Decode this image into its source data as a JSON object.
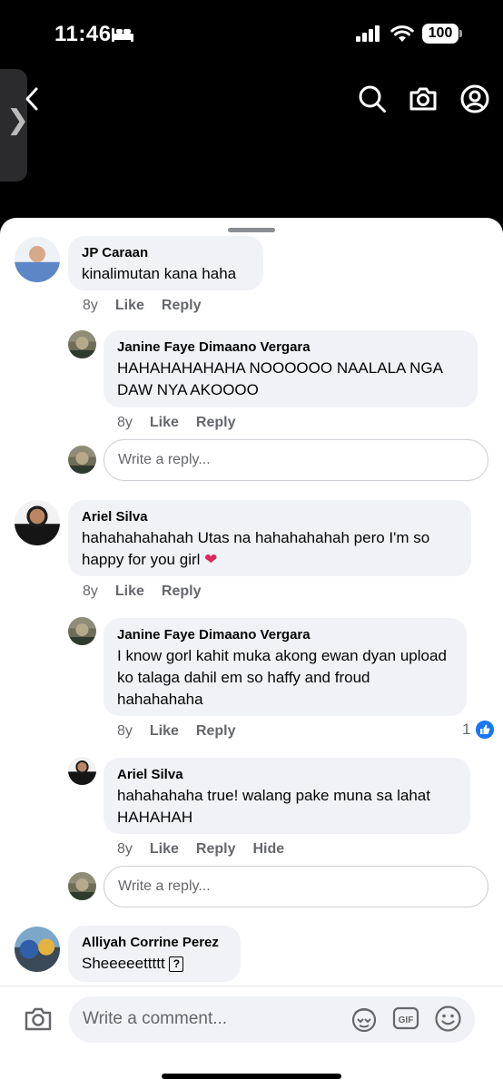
{
  "status_bar": {
    "time": "11:46",
    "battery": "100"
  },
  "comments": [
    {
      "author": "JP Caraan",
      "text": "kinalimutan kana haha",
      "age": "8y",
      "like": "Like",
      "reply": "Reply"
    },
    {
      "author": "Janine Faye Dimaano Vergara",
      "text": "HAHAHAHAHAHA NOOOOOO NAALALA NGA DAW NYA AKOOOO",
      "age": "8y",
      "like": "Like",
      "reply": "Reply"
    },
    {
      "author": "Ariel Silva",
      "text": "hahahahahahah Utas na hahahahahah pero I'm so happy for you girl",
      "age": "8y",
      "like": "Like",
      "reply": "Reply"
    },
    {
      "author": "Janine Faye Dimaano Vergara",
      "text": "I know gorl kahit muka akong ewan dyan upload ko talaga dahil em so haffy and froud hahahahaha",
      "age": "8y",
      "like": "Like",
      "reply": "Reply",
      "likes": "1"
    },
    {
      "author": "Ariel Silva",
      "text": "hahahahaha true! walang pake muna sa lahat HAHAHAH",
      "age": "8y",
      "like": "Like",
      "reply": "Reply",
      "hide": "Hide"
    },
    {
      "author": "Alliyah Corrine Perez",
      "text": "Sheeeeettttt"
    }
  ],
  "reply_placeholder": "Write a reply...",
  "composer": {
    "placeholder": "Write a comment..."
  },
  "colors": {
    "like_blue": "#1877f2",
    "bubble_bg": "#f0f2f5",
    "meta_text": "#65676b"
  },
  "icons": [
    "back-icon",
    "search-icon",
    "camera-icon",
    "profile-icon",
    "like-icon",
    "heart-emoji",
    "sticker-icon",
    "gif-icon",
    "emoji-icon"
  ]
}
